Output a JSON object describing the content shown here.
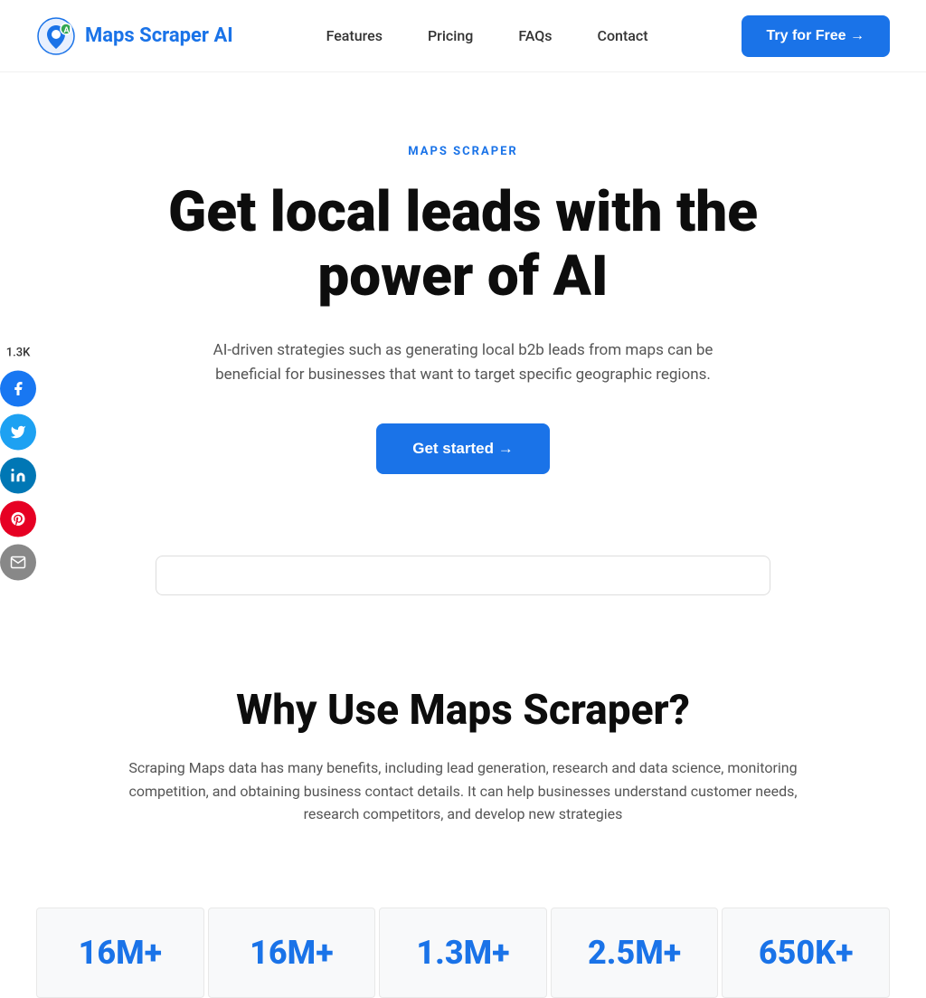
{
  "navbar": {
    "logo_text": "Maps Scraper AI",
    "links": [
      {
        "label": "Features",
        "href": "#"
      },
      {
        "label": "Pricing",
        "href": "#"
      },
      {
        "label": "FAQs",
        "href": "#"
      },
      {
        "label": "Contact",
        "href": "#"
      }
    ],
    "cta_label": "Try for Free →"
  },
  "social": {
    "count": "1.3K",
    "platforms": [
      "facebook",
      "twitter",
      "linkedin",
      "pinterest",
      "email"
    ]
  },
  "hero": {
    "badge": "MAPS SCRAPER",
    "title": "Get local leads with the power of AI",
    "subtitle": "AI-driven strategies such as generating local b2b leads from maps can be beneficial for businesses that want to target specific geographic regions.",
    "cta_label": "Get started →"
  },
  "why": {
    "title": "Why Use Maps Scraper?",
    "subtitle": "Scraping Maps data has many benefits, including lead generation, research and data science, monitoring competition, and obtaining business contact details. It can help businesses understand customer needs, research competitors, and develop new strategies"
  },
  "stats": [
    {
      "number": "16M+"
    },
    {
      "number": "16M+"
    },
    {
      "number": "1.3M+"
    },
    {
      "number": "2.5M+"
    },
    {
      "number": "650K+"
    }
  ],
  "icons": {
    "facebook": "f",
    "twitter": "t",
    "linkedin": "in",
    "pinterest": "p",
    "email": "✉"
  }
}
